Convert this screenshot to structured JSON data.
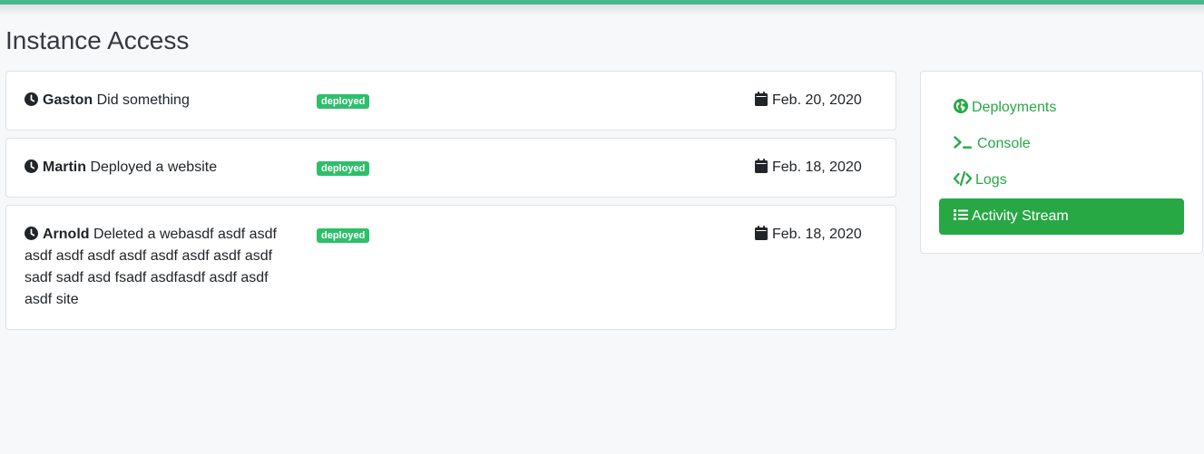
{
  "page": {
    "title": "Instance Access"
  },
  "colors": {
    "top_bar": "#48b88c",
    "accent_green": "#28a745",
    "badge_green": "#2ebf6b"
  },
  "activity": [
    {
      "icon": "clock-icon",
      "user": "Gaston",
      "action": "Did something",
      "badge": "deployed",
      "date_icon": "calendar-icon",
      "date": "Feb. 20, 2020"
    },
    {
      "icon": "clock-icon",
      "user": "Martin",
      "action": "Deployed a website",
      "badge": "deployed",
      "date_icon": "calendar-icon",
      "date": "Feb. 18, 2020"
    },
    {
      "icon": "clock-icon",
      "user": "Arnold",
      "action": "Deleted a webasdf asdf asdf asdf asdf asdf asdf asdf asdf asdf asdf sadf sadf asd fsadf asdfasdf asdf asdf asdf site",
      "badge": "deployed",
      "date_icon": "calendar-icon",
      "date": "Feb. 18, 2020"
    }
  ],
  "sidebar": {
    "items": [
      {
        "label": "Deployments",
        "icon": "globe-icon",
        "active": false
      },
      {
        "label": "Console",
        "icon": "terminal-icon",
        "active": false
      },
      {
        "label": "Logs",
        "icon": "code-icon",
        "active": false
      },
      {
        "label": "Activity Stream",
        "icon": "list-icon",
        "active": true
      }
    ]
  }
}
